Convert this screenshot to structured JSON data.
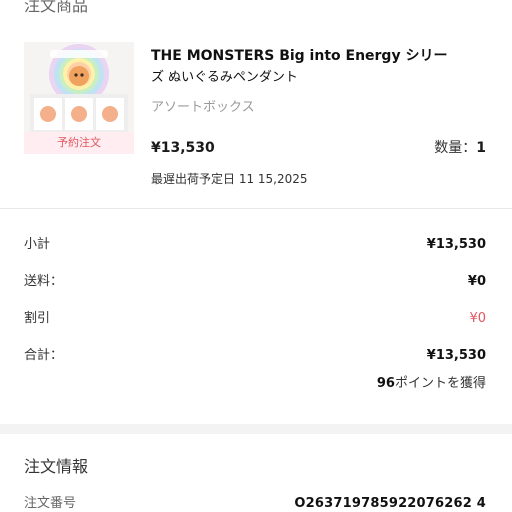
{
  "section_title": "注文商品",
  "product": {
    "name_line1": "THE MONSTERS Big into Energy シリー",
    "name_line2": "ズ ぬいぐるみペンダント",
    "variant": "アソートボックス",
    "price": "¥13,530",
    "quantity_label": "数量：",
    "quantity_value": "1",
    "ship_date": "最遅出荷予定日 11 15,2025",
    "badge": "予約注文",
    "image_icon": "product-box-image"
  },
  "summary": {
    "subtotal_label": "小計",
    "subtotal_value": "¥13,530",
    "shipping_label": "送料：",
    "shipping_value": "¥0",
    "discount_label": "割引",
    "discount_value": "¥0",
    "total_label": "合計：",
    "total_value": "¥13,530",
    "points_number": "96",
    "points_text": "ポイントを獲得"
  },
  "order_info": {
    "title": "注文情報",
    "order_number_label": "注文番号",
    "order_number_value": "O263719785922076262 4"
  },
  "colors": {
    "discount": "#e1565c",
    "badge_text": "#e1565c",
    "badge_bg": "#ffecf0",
    "divider": "#e8e8e8"
  }
}
